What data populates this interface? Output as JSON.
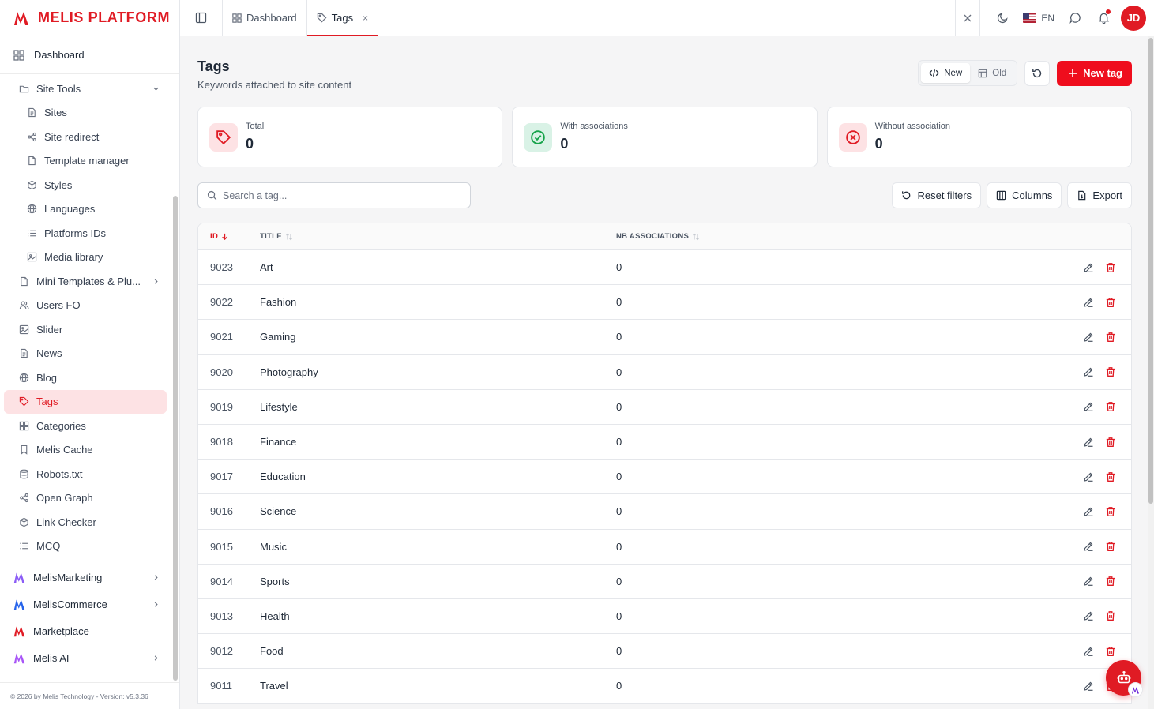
{
  "brand": {
    "name": "MELIS PLATFORM",
    "color": "#e01b24"
  },
  "sidebar": {
    "dashboard_label": "Dashboard",
    "items": [
      {
        "label": "Site Tools",
        "icon": "folder-icon",
        "level": 1,
        "expandable": "down"
      },
      {
        "label": "Sites",
        "icon": "document-icon",
        "level": 2
      },
      {
        "label": "Site redirect",
        "icon": "share-icon",
        "level": 2
      },
      {
        "label": "Template manager",
        "icon": "file-icon",
        "level": 2
      },
      {
        "label": "Styles",
        "icon": "cube-icon",
        "level": 2
      },
      {
        "label": "Languages",
        "icon": "globe-icon",
        "level": 2
      },
      {
        "label": "Platforms IDs",
        "icon": "list-icon",
        "level": 2
      },
      {
        "label": "Media library",
        "icon": "image-icon",
        "level": 2
      },
      {
        "label": "Mini Templates & Plu...",
        "icon": "file-icon",
        "level": 1,
        "expandable": "right"
      },
      {
        "label": "Users FO",
        "icon": "users-icon",
        "level": 1
      },
      {
        "label": "Slider",
        "icon": "image-icon",
        "level": 1
      },
      {
        "label": "News",
        "icon": "document-icon",
        "level": 1
      },
      {
        "label": "Blog",
        "icon": "globe-icon",
        "level": 1
      },
      {
        "label": "Tags",
        "icon": "tag-icon",
        "level": 1,
        "active": true
      },
      {
        "label": "Categories",
        "icon": "grid-icon",
        "level": 1
      },
      {
        "label": "Melis Cache",
        "icon": "bookmark-icon",
        "level": 1
      },
      {
        "label": "Robots.txt",
        "icon": "database-icon",
        "level": 1
      },
      {
        "label": "Open Graph",
        "icon": "share-icon",
        "level": 1
      },
      {
        "label": "Link Checker",
        "icon": "cube-icon",
        "level": 1
      },
      {
        "label": "MCQ",
        "icon": "list-icon",
        "level": 1
      }
    ],
    "products": [
      {
        "label": "MelisMarketing",
        "color": "#8b5cf6",
        "expandable": true
      },
      {
        "label": "MelisCommerce",
        "color": "#2563eb",
        "expandable": true
      },
      {
        "label": "Marketplace",
        "color": "#e01b24",
        "expandable": false
      },
      {
        "label": "Melis AI",
        "color": "#a855f7",
        "expandable": true
      }
    ],
    "footer": "© 2026 by Melis Technology - Version: v5.3.36"
  },
  "topbar": {
    "tabs": [
      {
        "label": "Dashboard",
        "icon": "grid-icon",
        "active": false
      },
      {
        "label": "Tags",
        "icon": "tag-icon",
        "active": true,
        "close": "×"
      }
    ],
    "close_all": "×",
    "language": "EN",
    "avatar_initials": "JD"
  },
  "page": {
    "title": "Tags",
    "subtitle": "Keywords attached to site content",
    "view_new": "New",
    "view_old": "Old",
    "new_tag_label": "New tag"
  },
  "stats": [
    {
      "label": "Total",
      "value": "0",
      "icon": "tag-icon",
      "bg": "#fde2e4",
      "fg": "#e01b24"
    },
    {
      "label": "With associations",
      "value": "0",
      "icon": "check-circle-icon",
      "bg": "#d9f2e6",
      "fg": "#16a34a"
    },
    {
      "label": "Without association",
      "value": "0",
      "icon": "x-circle-icon",
      "bg": "#fde2e4",
      "fg": "#e01b24"
    }
  ],
  "toolbar": {
    "search_placeholder": "Search a tag...",
    "reset_label": "Reset filters",
    "columns_label": "Columns",
    "export_label": "Export"
  },
  "table": {
    "columns": [
      "ID",
      "TITLE",
      "NB ASSOCIATIONS"
    ],
    "rows": [
      {
        "id": "9023",
        "title": "Art",
        "nb": "0"
      },
      {
        "id": "9022",
        "title": "Fashion",
        "nb": "0"
      },
      {
        "id": "9021",
        "title": "Gaming",
        "nb": "0"
      },
      {
        "id": "9020",
        "title": "Photography",
        "nb": "0"
      },
      {
        "id": "9019",
        "title": "Lifestyle",
        "nb": "0"
      },
      {
        "id": "9018",
        "title": "Finance",
        "nb": "0"
      },
      {
        "id": "9017",
        "title": "Education",
        "nb": "0"
      },
      {
        "id": "9016",
        "title": "Science",
        "nb": "0"
      },
      {
        "id": "9015",
        "title": "Music",
        "nb": "0"
      },
      {
        "id": "9014",
        "title": "Sports",
        "nb": "0"
      },
      {
        "id": "9013",
        "title": "Health",
        "nb": "0"
      },
      {
        "id": "9012",
        "title": "Food",
        "nb": "0"
      },
      {
        "id": "9011",
        "title": "Travel",
        "nb": "0"
      }
    ]
  },
  "accent": "#ef0d1d"
}
